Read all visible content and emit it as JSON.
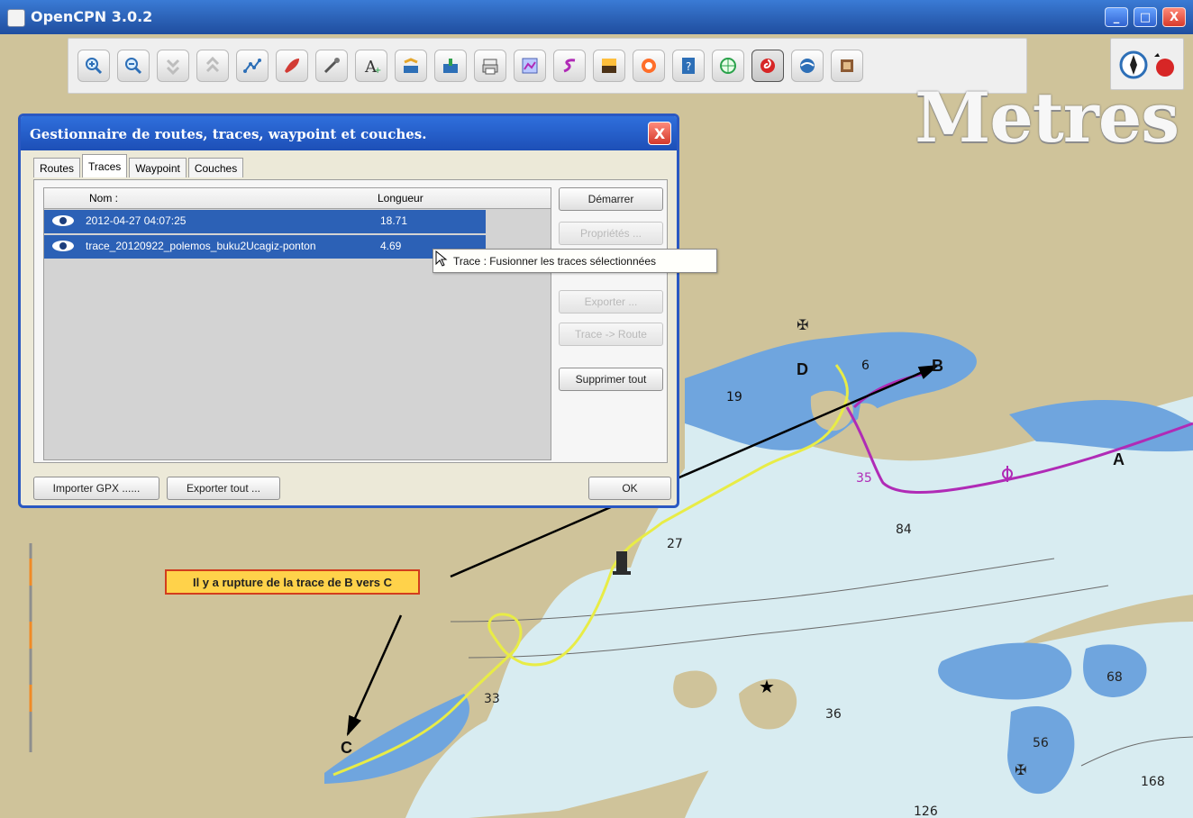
{
  "window": {
    "title": "OpenCPN 3.0.2",
    "controls": {
      "minimize": "_",
      "maximize": "□",
      "close": "X"
    }
  },
  "toolbar": {
    "tools": [
      {
        "name": "zoom-in-icon"
      },
      {
        "name": "zoom-out-icon"
      },
      {
        "name": "scale-in-icon"
      },
      {
        "name": "scale-out-icon"
      },
      {
        "name": "route-icon"
      },
      {
        "name": "follow-boat-icon"
      },
      {
        "name": "settings-icon"
      },
      {
        "name": "text-icon"
      },
      {
        "name": "currents-icon"
      },
      {
        "name": "tides-icon"
      },
      {
        "name": "print-icon"
      },
      {
        "name": "route-manager-icon"
      },
      {
        "name": "track-icon"
      },
      {
        "name": "color-scheme-icon"
      },
      {
        "name": "mob-icon"
      },
      {
        "name": "help-icon"
      },
      {
        "name": "radar-icon"
      },
      {
        "name": "record-track-icon",
        "active": true
      },
      {
        "name": "google-earth-icon"
      },
      {
        "name": "plugin-icon"
      }
    ]
  },
  "map": {
    "units_label": "Metres",
    "labels": [
      "A",
      "B",
      "C",
      "D"
    ],
    "depths": [
      "19",
      "6",
      "35",
      "84",
      "27",
      "33",
      "36",
      "68",
      "56",
      "168",
      "126"
    ],
    "annotation": "Il y a rupture de la trace de B vers C"
  },
  "dialog": {
    "title": "Gestionnaire de routes, traces, waypoint et couches.",
    "close": "X",
    "tabs": [
      {
        "label": "Routes"
      },
      {
        "label": "Traces",
        "active": true
      },
      {
        "label": "Waypoint"
      },
      {
        "label": "Couches"
      }
    ],
    "columns": {
      "name": "Nom :",
      "length": "Longueur"
    },
    "rows": [
      {
        "name": "2012-04-27 04:07:25",
        "length": "18.71"
      },
      {
        "name": "trace_20120922_polemos_buku2Ucagiz-ponton",
        "length": "4.69"
      }
    ],
    "buttons": {
      "start": "Démarrer",
      "properties": "Propriétés ...",
      "export": "Exporter ...",
      "track_to_route": "Trace -> Route",
      "delete_all": "Supprimer tout",
      "import_gpx": "Importer GPX ......",
      "export_all": "Exporter tout ...",
      "ok": "OK"
    },
    "tooltip": "Trace : Fusionner les traces sélectionnées"
  },
  "colors": {
    "land": "#cfc39a",
    "shallow_water": "#d8ecf1",
    "deep_water": "#6fa5de",
    "trace": "#e8ec46",
    "route": "#b02bb6",
    "dialog_selection": "#2c61b6"
  }
}
